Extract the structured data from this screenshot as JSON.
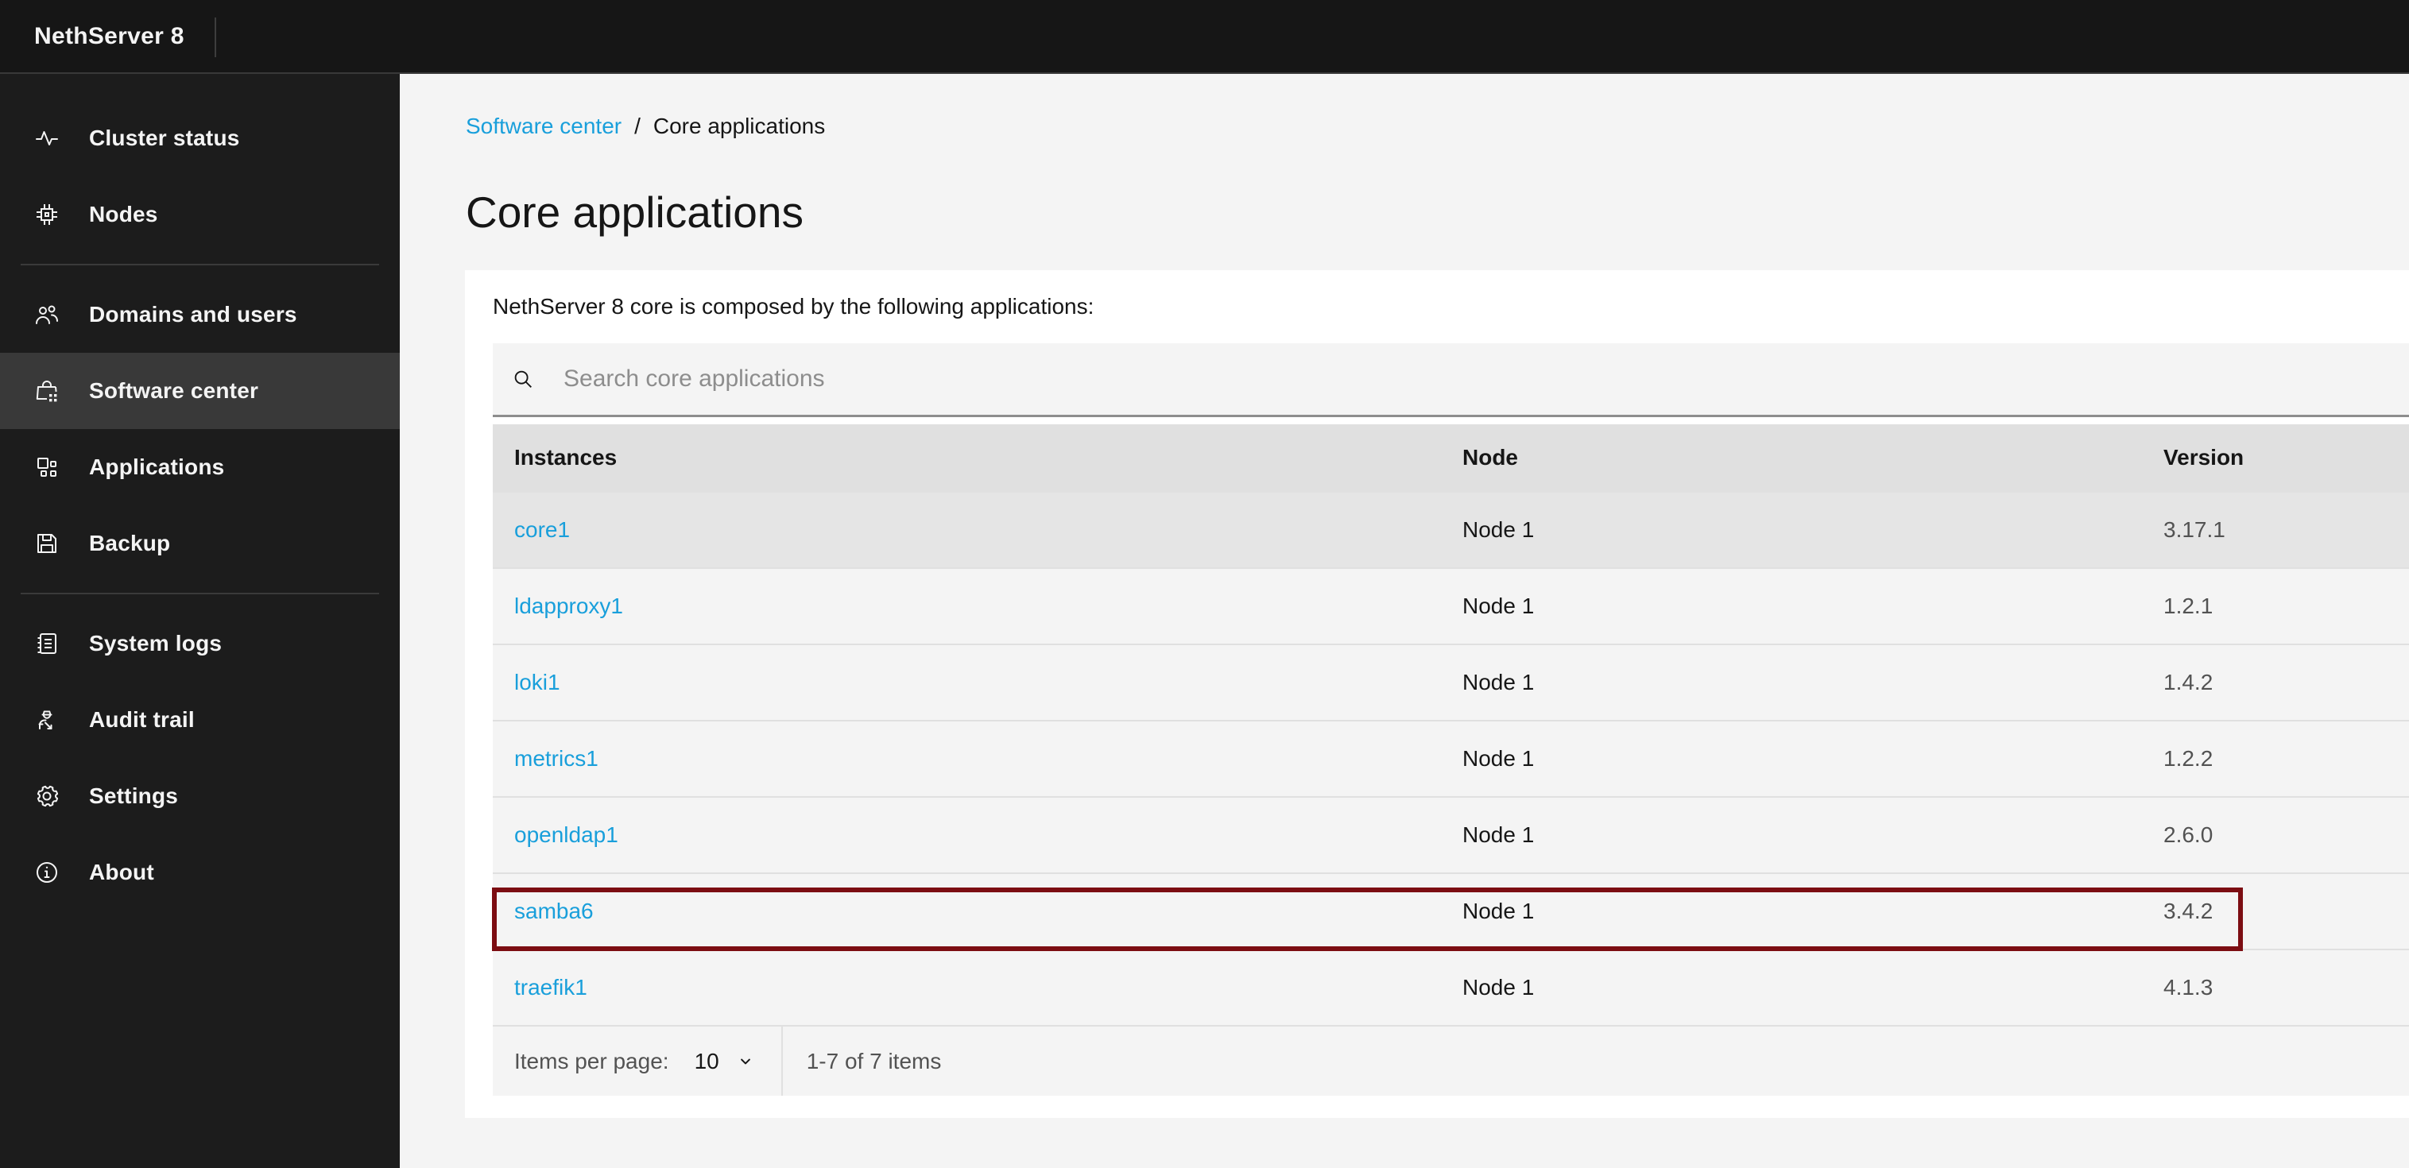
{
  "header": {
    "app_title": "NethServer 8"
  },
  "sidebar": {
    "selected": "Software center",
    "items": [
      {
        "label": "Cluster status",
        "icon": "activity-icon"
      },
      {
        "label": "Nodes",
        "icon": "chip-icon"
      },
      {
        "label": "Domains and users",
        "icon": "group-icon"
      },
      {
        "label": "Software center",
        "icon": "software-bag-icon"
      },
      {
        "label": "Applications",
        "icon": "apps-grid-icon"
      },
      {
        "label": "Backup",
        "icon": "save-icon"
      },
      {
        "label": "System logs",
        "icon": "catalog-icon"
      },
      {
        "label": "Audit trail",
        "icon": "audit-officer-icon"
      },
      {
        "label": "Settings",
        "icon": "gear-icon"
      },
      {
        "label": "About",
        "icon": "info-icon"
      }
    ]
  },
  "breadcrumb": {
    "parent": "Software center",
    "separator": "/",
    "current": "Core applications"
  },
  "page": {
    "title": "Core applications",
    "description": "NethServer 8 core is composed by the following applications:"
  },
  "search": {
    "placeholder": "Search core applications",
    "value": ""
  },
  "table": {
    "columns": [
      "Instances",
      "Node",
      "Version"
    ],
    "rows": [
      {
        "instance": "core1",
        "node": "Node 1",
        "version": "3.17.1"
      },
      {
        "instance": "ldapproxy1",
        "node": "Node 1",
        "version": "1.2.1"
      },
      {
        "instance": "loki1",
        "node": "Node 1",
        "version": "1.4.2"
      },
      {
        "instance": "metrics1",
        "node": "Node 1",
        "version": "1.2.2"
      },
      {
        "instance": "openldap1",
        "node": "Node 1",
        "version": "2.6.0"
      },
      {
        "instance": "samba6",
        "node": "Node 1",
        "version": "3.4.2"
      },
      {
        "instance": "traefik1",
        "node": "Node 1",
        "version": "4.1.3"
      }
    ],
    "highlighted_row": "samba6"
  },
  "pagination": {
    "items_per_page_label": "Items per page:",
    "items_per_page": "10",
    "range_text": "1-7 of 7 items"
  },
  "colors": {
    "link": "#199fdb",
    "highlight_border": "#7c0d12",
    "top_header_bg": "#161616",
    "sidebar_bg": "#1c1c1c",
    "selected_item_bg": "#393939",
    "page_bg": "#f4f4f4",
    "card_bg": "#ffffff",
    "table_header_bg": "#e0e0e0",
    "row_bg": "#f4f4f4",
    "hovered_row_bg": "#e5e5e5"
  }
}
